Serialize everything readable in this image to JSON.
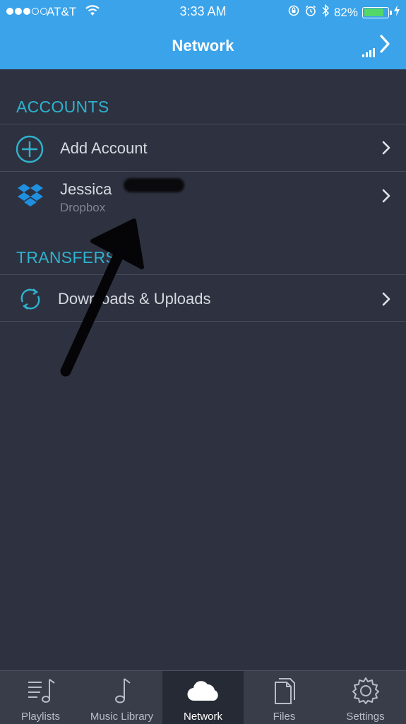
{
  "status_bar": {
    "carrier": "AT&T",
    "time": "3:33 AM",
    "battery_percent": "82%",
    "battery_level": 0.82,
    "signal_bars_filled": 3,
    "signal_bars_total": 5,
    "icons": [
      "wifi-icon",
      "rotation-lock-icon",
      "alarm-icon",
      "bluetooth-icon",
      "battery-icon",
      "charging-icon"
    ]
  },
  "nav": {
    "title": "Network",
    "right_action_icon": "signal-chevron-icon"
  },
  "colors": {
    "header": "#3aa3ea",
    "background": "#2e3240",
    "section_heading": "#2fb3cf",
    "tabbar": "#393d4a",
    "tab_active": "#262a35"
  },
  "sections": {
    "accounts": {
      "heading": "ACCOUNTS",
      "add_account": {
        "label": "Add Account",
        "icon": "plus-circle-icon"
      },
      "account": {
        "name": "Jessica",
        "service": "Dropbox",
        "icon": "dropbox-icon"
      }
    },
    "transfers": {
      "heading": "TRANSFERS",
      "downloads": {
        "label": "Downloads & Uploads",
        "icon": "sync-icon"
      }
    }
  },
  "tabs": [
    {
      "label": "Playlists",
      "icon": "playlist-icon",
      "active": false
    },
    {
      "label": "Music Library",
      "icon": "music-note-icon",
      "active": false
    },
    {
      "label": "Network",
      "icon": "cloud-icon",
      "active": true
    },
    {
      "label": "Files",
      "icon": "files-icon",
      "active": false
    },
    {
      "label": "Settings",
      "icon": "gear-icon",
      "active": false
    }
  ]
}
